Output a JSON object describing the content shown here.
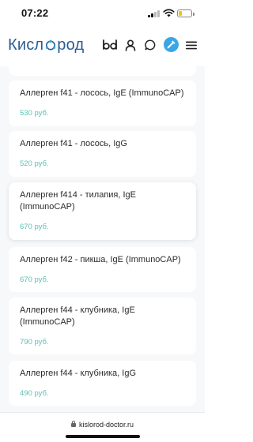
{
  "status_bar": {
    "time": "07:22",
    "battery_level": 0.25,
    "battery_color": "#f2c318"
  },
  "header": {
    "logo_text_left": "Кисл",
    "logo_text_right": "род",
    "icons": [
      "bd-icon",
      "user-icon",
      "chat-icon",
      "pen-icon",
      "menu-icon"
    ],
    "accent_color": "#3aa6e6"
  },
  "products": [
    {
      "title": "Аллерген f41 - лосось, IgE (ImmunoCAP)",
      "price": "530 руб."
    },
    {
      "title": "Аллерген f41 - лосось, IgG",
      "price": "520 руб."
    },
    {
      "title": "Аллерген f414 - тилапия, IgE (ImmunoCAP)",
      "price": "670 руб."
    },
    {
      "title": "Аллерген f42 - пикша, IgE (ImmunoCAP)",
      "price": "670 руб."
    },
    {
      "title": "Аллерген f44 - клубника, IgE (ImmunoCAP)",
      "price": "790 руб."
    },
    {
      "title": "Аллерген f44 - клубника, IgG",
      "price": "490 руб."
    }
  ],
  "price_color": "#5bc0b5",
  "browser": {
    "url": "kislorod-doctor.ru"
  }
}
